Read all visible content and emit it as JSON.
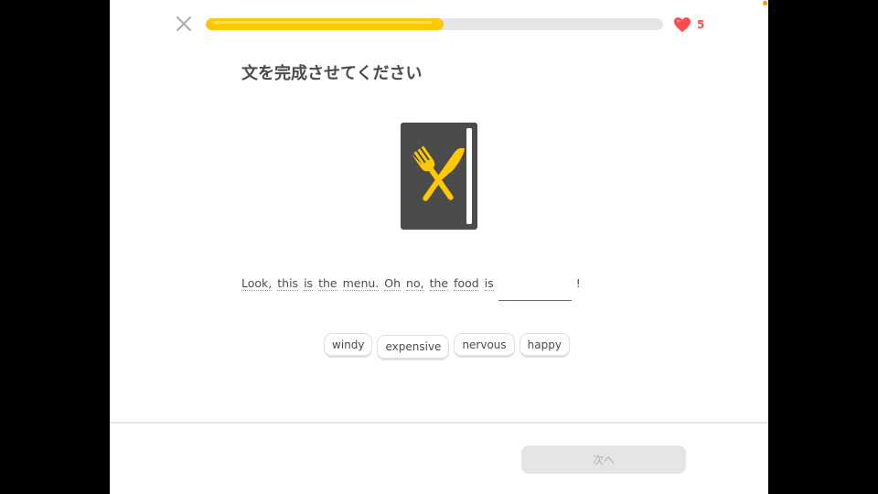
{
  "header": {
    "close_icon": "close-icon",
    "progress": {
      "fraction": 0.52,
      "fill_color": "#ffc800",
      "track_color": "#e5e5e5"
    },
    "hearts": {
      "icon": "heart-icon",
      "count": "5",
      "color": "#ff4b4b"
    }
  },
  "prompt": {
    "title": "文を完成させてください"
  },
  "illustration": {
    "icon": "menu-book-icon"
  },
  "sentence": {
    "words": [
      "Look,",
      "this",
      "is",
      "the",
      "menu.",
      "Oh",
      "no,",
      "the",
      "food",
      "is"
    ],
    "end_punct": "!"
  },
  "choices": [
    "windy",
    "expensive",
    "nervous",
    "happy"
  ],
  "footer": {
    "next_label": "次へ"
  }
}
